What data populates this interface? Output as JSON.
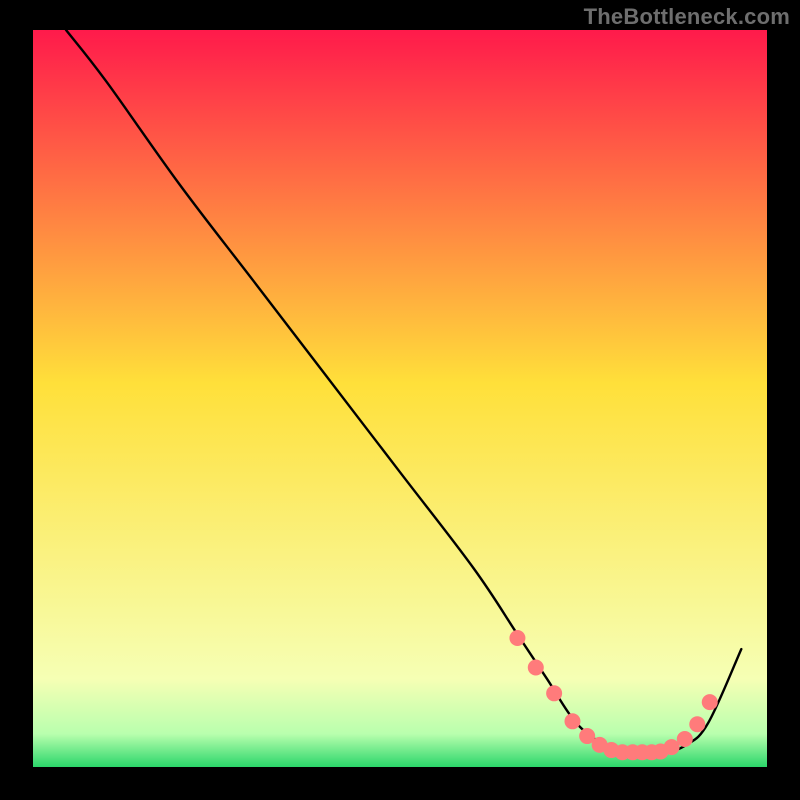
{
  "watermark": {
    "text": "TheBottleneck.com"
  },
  "chart_data": {
    "type": "line",
    "title": "",
    "xlabel": "",
    "ylabel": "",
    "xlim": [
      0,
      100
    ],
    "ylim": [
      0,
      100
    ],
    "grid": false,
    "legend": "none",
    "background_gradient_stops": [
      {
        "pos": 0.0,
        "color": "#ff1a4b"
      },
      {
        "pos": 0.48,
        "color": "#ffe03a"
      },
      {
        "pos": 0.88,
        "color": "#f6ffb4"
      },
      {
        "pos": 0.955,
        "color": "#b9ffae"
      },
      {
        "pos": 1.0,
        "color": "#2bd66a"
      }
    ],
    "series": [
      {
        "name": "bottleneck-curve",
        "x": [
          4.5,
          10,
          20,
          30,
          40,
          50,
          60,
          66,
          70,
          74,
          78,
          82,
          86,
          89,
          92,
          96.5
        ],
        "y": [
          100,
          93,
          79,
          66,
          53,
          40,
          27,
          18,
          12,
          6,
          3,
          2,
          2,
          3,
          6,
          16
        ]
      }
    ],
    "markers": {
      "name": "highlight-dots",
      "color": "#ff7b7b",
      "radius": 8,
      "x": [
        66,
        68.5,
        71,
        73.5,
        75.5,
        77.2,
        78.8,
        80.3,
        81.7,
        83.0,
        84.3,
        85.5,
        87.0,
        88.8,
        90.5,
        92.2
      ],
      "y": [
        17.5,
        13.5,
        10.0,
        6.2,
        4.2,
        3.0,
        2.3,
        2.0,
        2.0,
        2.0,
        2.0,
        2.1,
        2.7,
        3.8,
        5.8,
        8.8
      ]
    }
  }
}
